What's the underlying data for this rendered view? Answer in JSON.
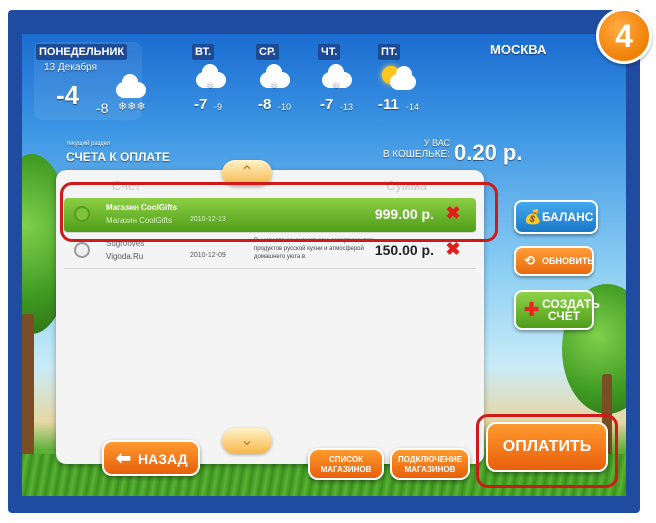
{
  "step_badge": "4",
  "weather": {
    "today": {
      "day": "ПОНЕДЕЛЬНИК",
      "date": "13 Декабря",
      "temp": "-4",
      "night_temp": "-8"
    },
    "forecast": [
      {
        "day": "ВТ.",
        "temp": "-7",
        "night": "-9",
        "icon": "snow-cloud-icon"
      },
      {
        "day": "СР.",
        "temp": "-8",
        "night": "-10",
        "icon": "snow-cloud-icon"
      },
      {
        "day": "ЧТ.",
        "temp": "-7",
        "night": "-13",
        "icon": "snow-cloud-icon"
      },
      {
        "day": "ПТ.",
        "temp": "-11",
        "night": "-14",
        "icon": "sun-cloud-icon"
      }
    ],
    "city": "МОСКВА"
  },
  "section": {
    "caption": "текущий раздел",
    "title": "СЧЕТА К ОПЛАТЕ"
  },
  "wallet": {
    "label_line1": "У ВАС",
    "label_line2": "В КОШЕЛЬКЕ:",
    "amount": "0.20 р."
  },
  "table": {
    "headers": {
      "account": "Счет",
      "sum": "Сумма"
    },
    "rows": [
      {
        "name": "Магазин CoolGifts",
        "sub": "Магазин CoolGifts",
        "date": "2010-12-13",
        "desc": "",
        "amount": "999.00 р.",
        "selected": true
      },
      {
        "name": "Sugrooves",
        "sub": "Vigoda.Ru",
        "date": "2010-12-09",
        "desc": "Вы можете ознакомиться с ассортиментом продуктов русской кухни и атмосферой домашнего уюта в",
        "amount": "150.00 р.",
        "selected": false
      }
    ]
  },
  "buttons": {
    "balance": "БАЛАНС",
    "refresh": "ОБНОВИТЬ",
    "create": "СОЗДАТЬ СЧЕТ",
    "back": "НАЗАД",
    "shops": "СПИСОК МАГАЗИНОВ",
    "connect": "ПОДКЛЮЧЕНИЕ МАГАЗИНОВ",
    "pay": "ОПЛАТИТЬ"
  },
  "colors": {
    "frame": "#1f4ca0",
    "badge": "#f07f05",
    "selected_row": "#5aa623",
    "highlight": "#d01a1a",
    "side_button": "#1e8fd8"
  }
}
